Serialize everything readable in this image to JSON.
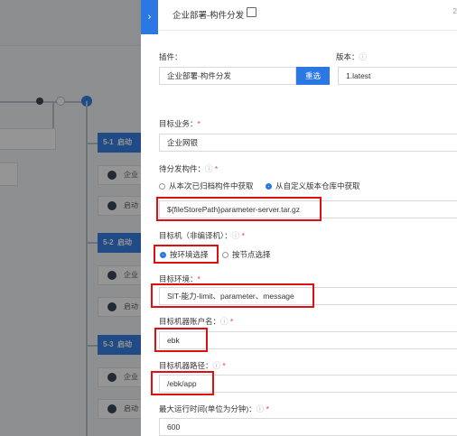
{
  "header": {
    "title": "企业部署-构件分发",
    "more": "2"
  },
  "plugin": {
    "label": "插件：",
    "value": "企业部署-构件分发",
    "select_button": "重选"
  },
  "version": {
    "label": "版本：",
    "hint": "ⓘ",
    "value": "1.latest"
  },
  "target_service": {
    "label": "目标业务：",
    "required": "*",
    "value": "企业网银"
  },
  "artifact": {
    "label": "待分发构件：",
    "hint": "ⓘ",
    "required": "*",
    "options": [
      "从本次已归档构件中获取",
      "从自定义版本仓库中获取"
    ],
    "selected": 1,
    "value": "${fileStorePath}parameter-server.tar.gz"
  },
  "target_machine": {
    "label": "目标机（非编译机）：",
    "hint": "ⓘ",
    "required": "*",
    "options": [
      "按环境选择",
      "按节点选择"
    ],
    "selected": 0
  },
  "target_env": {
    "label": "目标环境：",
    "required": "*",
    "value": "SIT-能力-limit、parameter、message"
  },
  "account": {
    "label": "目标机器账户名：",
    "hint": "ⓘ",
    "required": "*",
    "value": "ebk"
  },
  "path": {
    "label": "目标机器路径：",
    "hint": "ⓘ",
    "required": "*",
    "value": "/ebk/app"
  },
  "max_time": {
    "label": "最大运行时间(单位为分钟)：",
    "hint": "ⓘ",
    "required": "*",
    "value": "600"
  },
  "pipeline": {
    "stages": [
      "5-1",
      "5-2",
      "5-3"
    ],
    "stage_text": "启动",
    "step_texts": [
      "企业",
      "启动"
    ]
  }
}
